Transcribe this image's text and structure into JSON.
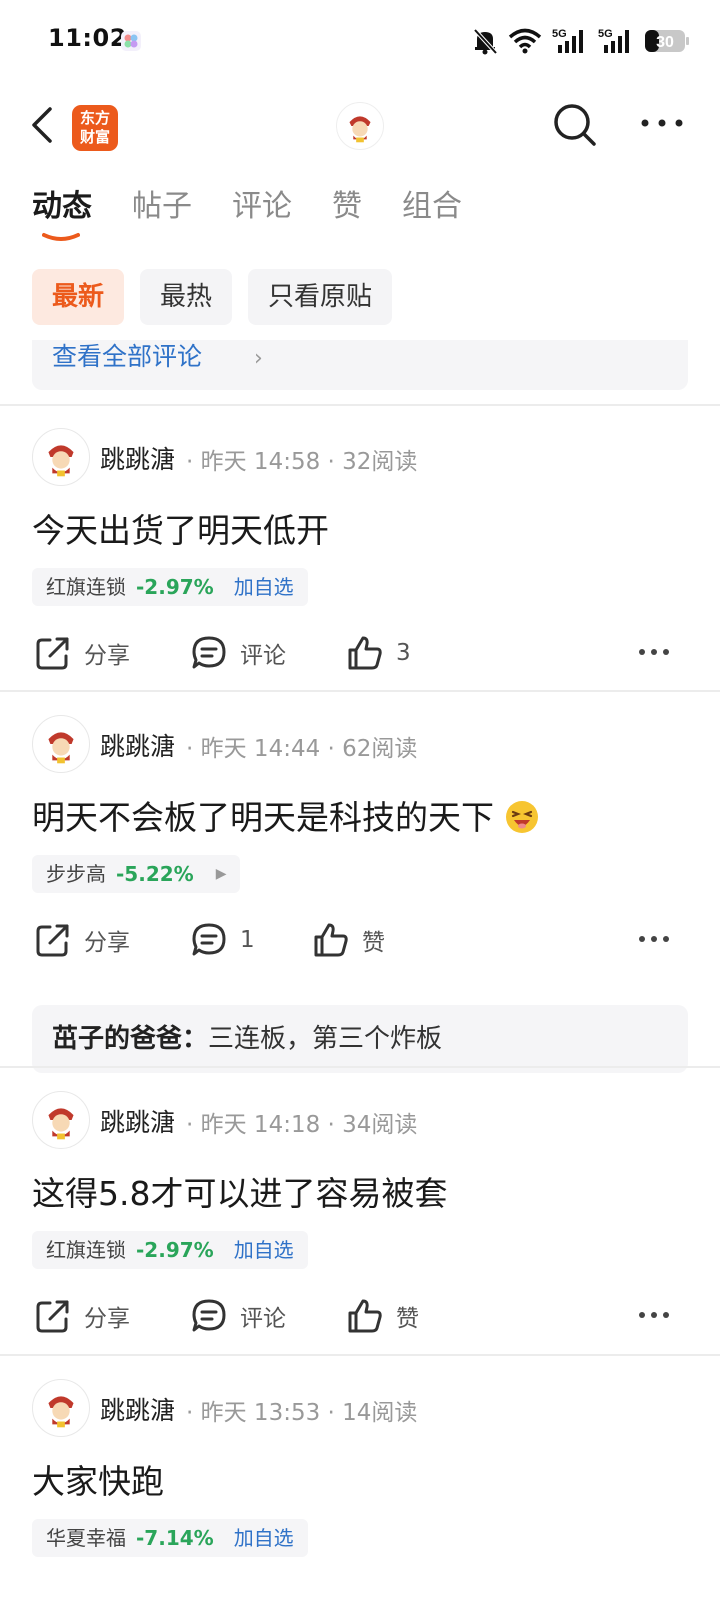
{
  "status_bar": {
    "time": "11:02",
    "battery": "30",
    "network_1": "5G",
    "network_2": "5G"
  },
  "nav": {
    "logo_line1": "东方",
    "logo_line2": "财富"
  },
  "tabs": [
    {
      "label": "动态",
      "active": true
    },
    {
      "label": "帖子",
      "active": false
    },
    {
      "label": "评论",
      "active": false
    },
    {
      "label": "赞",
      "active": false
    },
    {
      "label": "组合",
      "active": false
    }
  ],
  "filters": [
    {
      "label": "最新",
      "active": true
    },
    {
      "label": "最热",
      "active": false
    },
    {
      "label": "只看原贴",
      "active": false
    }
  ],
  "view_all_comments": "查看全部评论",
  "posts": [
    {
      "author": "跳跳溏",
      "meta": "· 昨天 14:58 · 32阅读",
      "content": "今天出货了明天低开",
      "stock": {
        "name": "红旗连锁",
        "change": "-2.97%",
        "action": "加自选"
      },
      "actions": {
        "share": "分享",
        "comment": "评论",
        "like": "3"
      }
    },
    {
      "author": "跳跳溏",
      "meta": "· 昨天 14:44 · 62阅读",
      "content": "明天不会板了明天是科技的天下",
      "stock": {
        "name": "步步高",
        "change": "-5.22%"
      },
      "actions": {
        "share": "分享",
        "comment": "1",
        "like": "赞"
      },
      "reply": {
        "author": "茁子的爸爸：",
        "text": "三连板，第三个炸板"
      }
    },
    {
      "author": "跳跳溏",
      "meta": "· 昨天 14:18 · 34阅读",
      "content": "这得5.8才可以进了容易被套",
      "stock": {
        "name": "红旗连锁",
        "change": "-2.97%",
        "action": "加自选"
      },
      "actions": {
        "share": "分享",
        "comment": "评论",
        "like": "赞"
      }
    },
    {
      "author": "跳跳溏",
      "meta": "· 昨天 13:53 · 14阅读",
      "content": "大家快跑",
      "stock": {
        "name": "华夏幸福",
        "change": "-7.14%",
        "action": "加自选"
      }
    }
  ],
  "colors": {
    "accent": "#ec5a1c",
    "link": "#2f72c8",
    "down": "#2aa55a"
  }
}
